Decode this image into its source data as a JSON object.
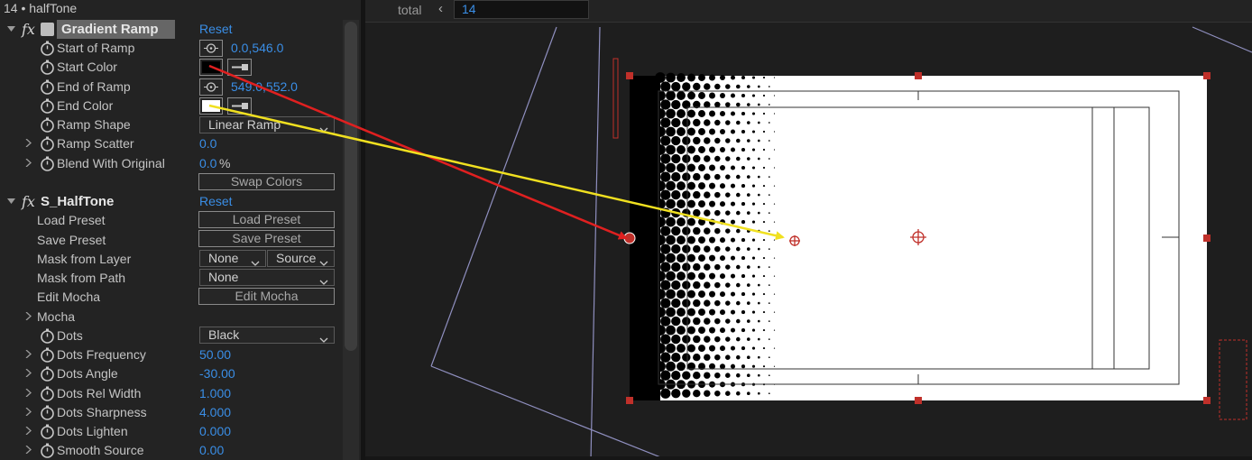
{
  "panel": {
    "title": "14 • halfTone",
    "effects": [
      {
        "name": "Gradient Ramp",
        "reset_label": "Reset",
        "properties": {
          "start_of_ramp": {
            "label": "Start of Ramp",
            "value": "0.0,546.0"
          },
          "start_color": {
            "label": "Start Color",
            "color": "#000000"
          },
          "end_of_ramp": {
            "label": "End of Ramp",
            "value": "549.0,552.0"
          },
          "end_color": {
            "label": "End Color",
            "color": "#ffffff"
          },
          "ramp_shape": {
            "label": "Ramp Shape",
            "value": "Linear Ramp"
          },
          "ramp_scatter": {
            "label": "Ramp Scatter",
            "value": "0.0"
          },
          "blend_with_original": {
            "label": "Blend With Original",
            "value": "0.0",
            "unit": "%"
          },
          "swap_colors": {
            "label": "Swap Colors"
          }
        }
      },
      {
        "name": "S_HalfTone",
        "reset_label": "Reset",
        "properties": {
          "load_preset": {
            "label": "Load Preset",
            "button": "Load Preset"
          },
          "save_preset": {
            "label": "Save Preset",
            "button": "Save Preset"
          },
          "mask_from_layer": {
            "label": "Mask from Layer",
            "value": "None",
            "source": "Source"
          },
          "mask_from_path": {
            "label": "Mask from Path",
            "value": "None"
          },
          "edit_mocha": {
            "label": "Edit Mocha",
            "button": "Edit Mocha"
          },
          "mocha": {
            "label": "Mocha"
          },
          "dots": {
            "label": "Dots",
            "value": "Black"
          },
          "dots_frequency": {
            "label": "Dots Frequency",
            "value": "50.00"
          },
          "dots_angle": {
            "label": "Dots Angle",
            "value": "-30.00"
          },
          "dots_rel_width": {
            "label": "Dots Rel Width",
            "value": "1.000"
          },
          "dots_sharpness": {
            "label": "Dots Sharpness",
            "value": "4.000"
          },
          "dots_lighten": {
            "label": "Dots Lighten",
            "value": "0.000"
          },
          "smooth_source": {
            "label": "Smooth Source",
            "value": "0.00"
          }
        }
      }
    ]
  },
  "viewer": {
    "total_label": "total",
    "total_value": "14"
  },
  "colors": {
    "accent_value": "#3a8ee6",
    "annotation_red": "#e02020",
    "annotation_yellow": "#f0e020",
    "handle": "#c0302a"
  }
}
